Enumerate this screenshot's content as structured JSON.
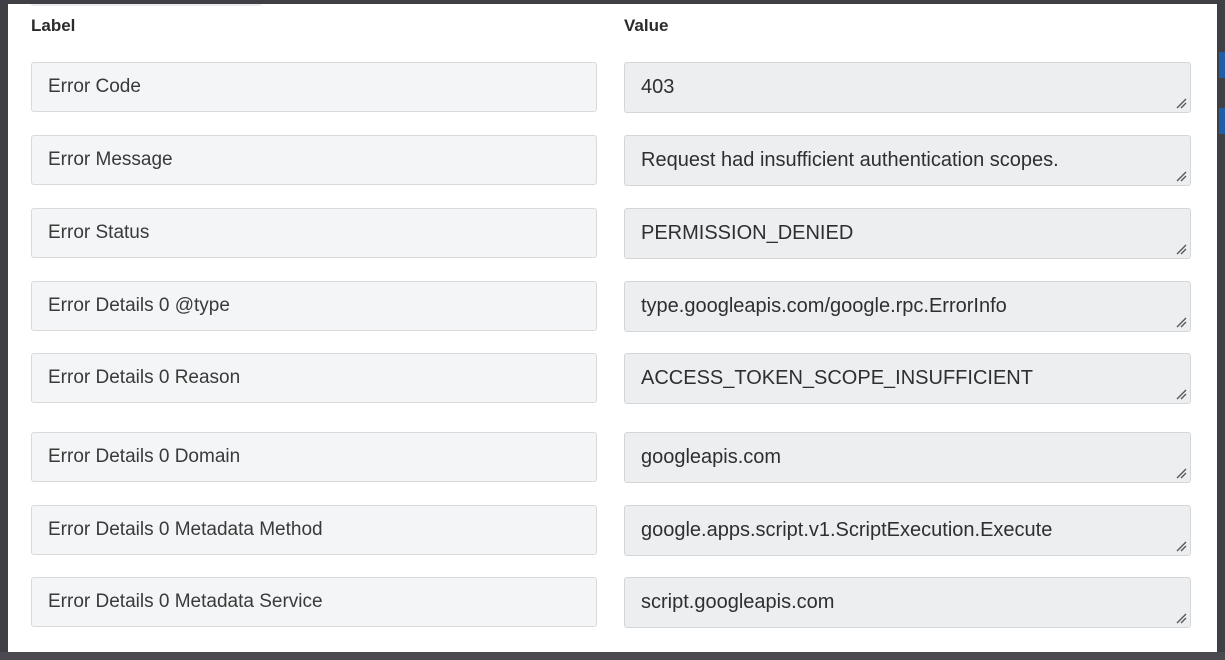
{
  "header": {
    "label_col": "Label",
    "value_col": "Value"
  },
  "fields": [
    {
      "label": "Error Code",
      "value": "403"
    },
    {
      "label": "Error Message",
      "value": "Request had insufficient authentication scopes."
    },
    {
      "label": "Error Status",
      "value": "PERMISSION_DENIED"
    },
    {
      "label": "Error Details 0 @type",
      "value": "type.googleapis.com/google.rpc.ErrorInfo"
    },
    {
      "label": "Error Details 0 Reason",
      "value": "ACCESS_TOKEN_SCOPE_INSUFFICIENT"
    },
    {
      "label": "Error Details 0 Domain",
      "value": "googleapis.com"
    },
    {
      "label": "Error Details 0 Metadata Method",
      "value": "google.apps.script.v1.ScriptExecution.Execute"
    },
    {
      "label": "Error Details 0 Metadata Service",
      "value": "script.googleapis.com"
    }
  ],
  "icons": {
    "resize": "resize-handle-icon"
  },
  "colors": {
    "overlay": "#403f45",
    "label_bg": "#f3f5f6",
    "value_bg": "#eceef0",
    "accent_bar": "#1f5ea8"
  }
}
